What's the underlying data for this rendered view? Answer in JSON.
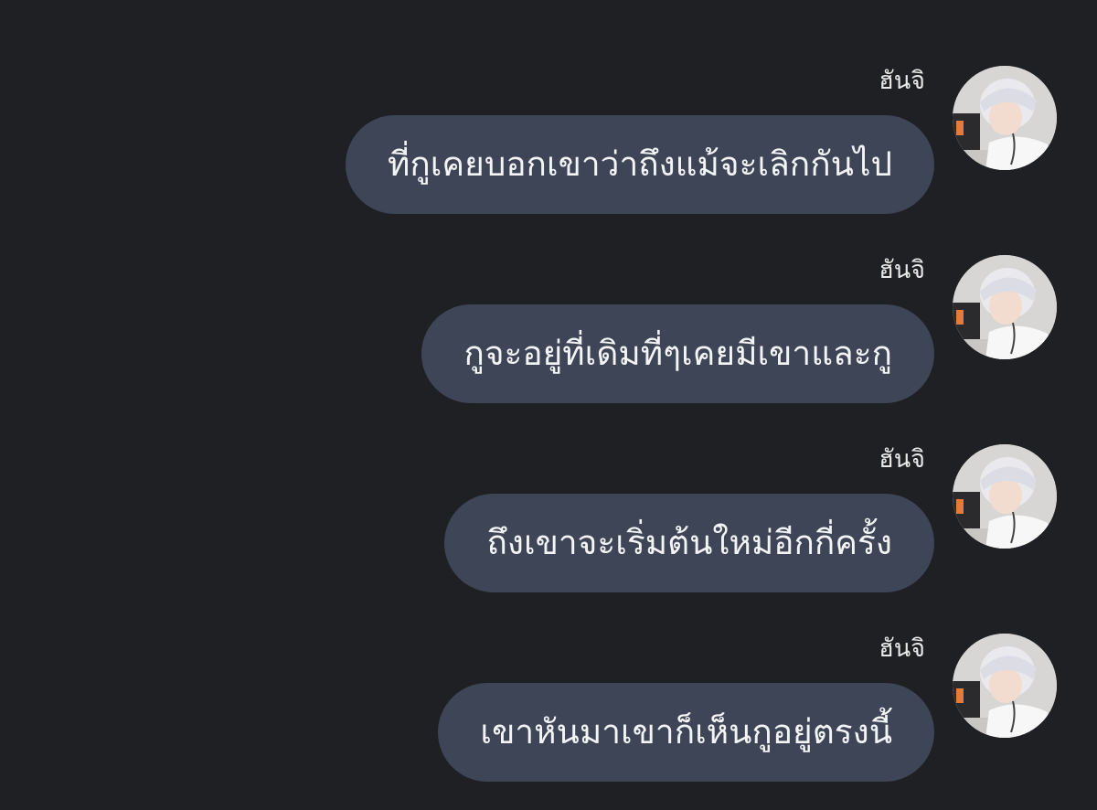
{
  "messages": [
    {
      "sender": "ฮันจิ",
      "text": "ที่กูเคยบอกเขาว่าถึงแม้จะเลิกกันไป",
      "avatar_icon": "user-avatar-silver-hair"
    },
    {
      "sender": "ฮันจิ",
      "text": "กูจะอยู่ที่เดิมที่ๆเคยมีเขาและกู",
      "avatar_icon": "user-avatar-silver-hair"
    },
    {
      "sender": "ฮันจิ",
      "text": "ถึงเขาจะเริ่มต้นใหม่อีกกี่ครั้ง",
      "avatar_icon": "user-avatar-silver-hair"
    },
    {
      "sender": "ฮันจิ",
      "text": "เขาหันมาเขาก็เห็นกูอยู่ตรงนี้",
      "avatar_icon": "user-avatar-silver-hair"
    }
  ],
  "colors": {
    "background": "#1f2023",
    "bubble": "#3d4556",
    "text": "#f3f4f6"
  }
}
